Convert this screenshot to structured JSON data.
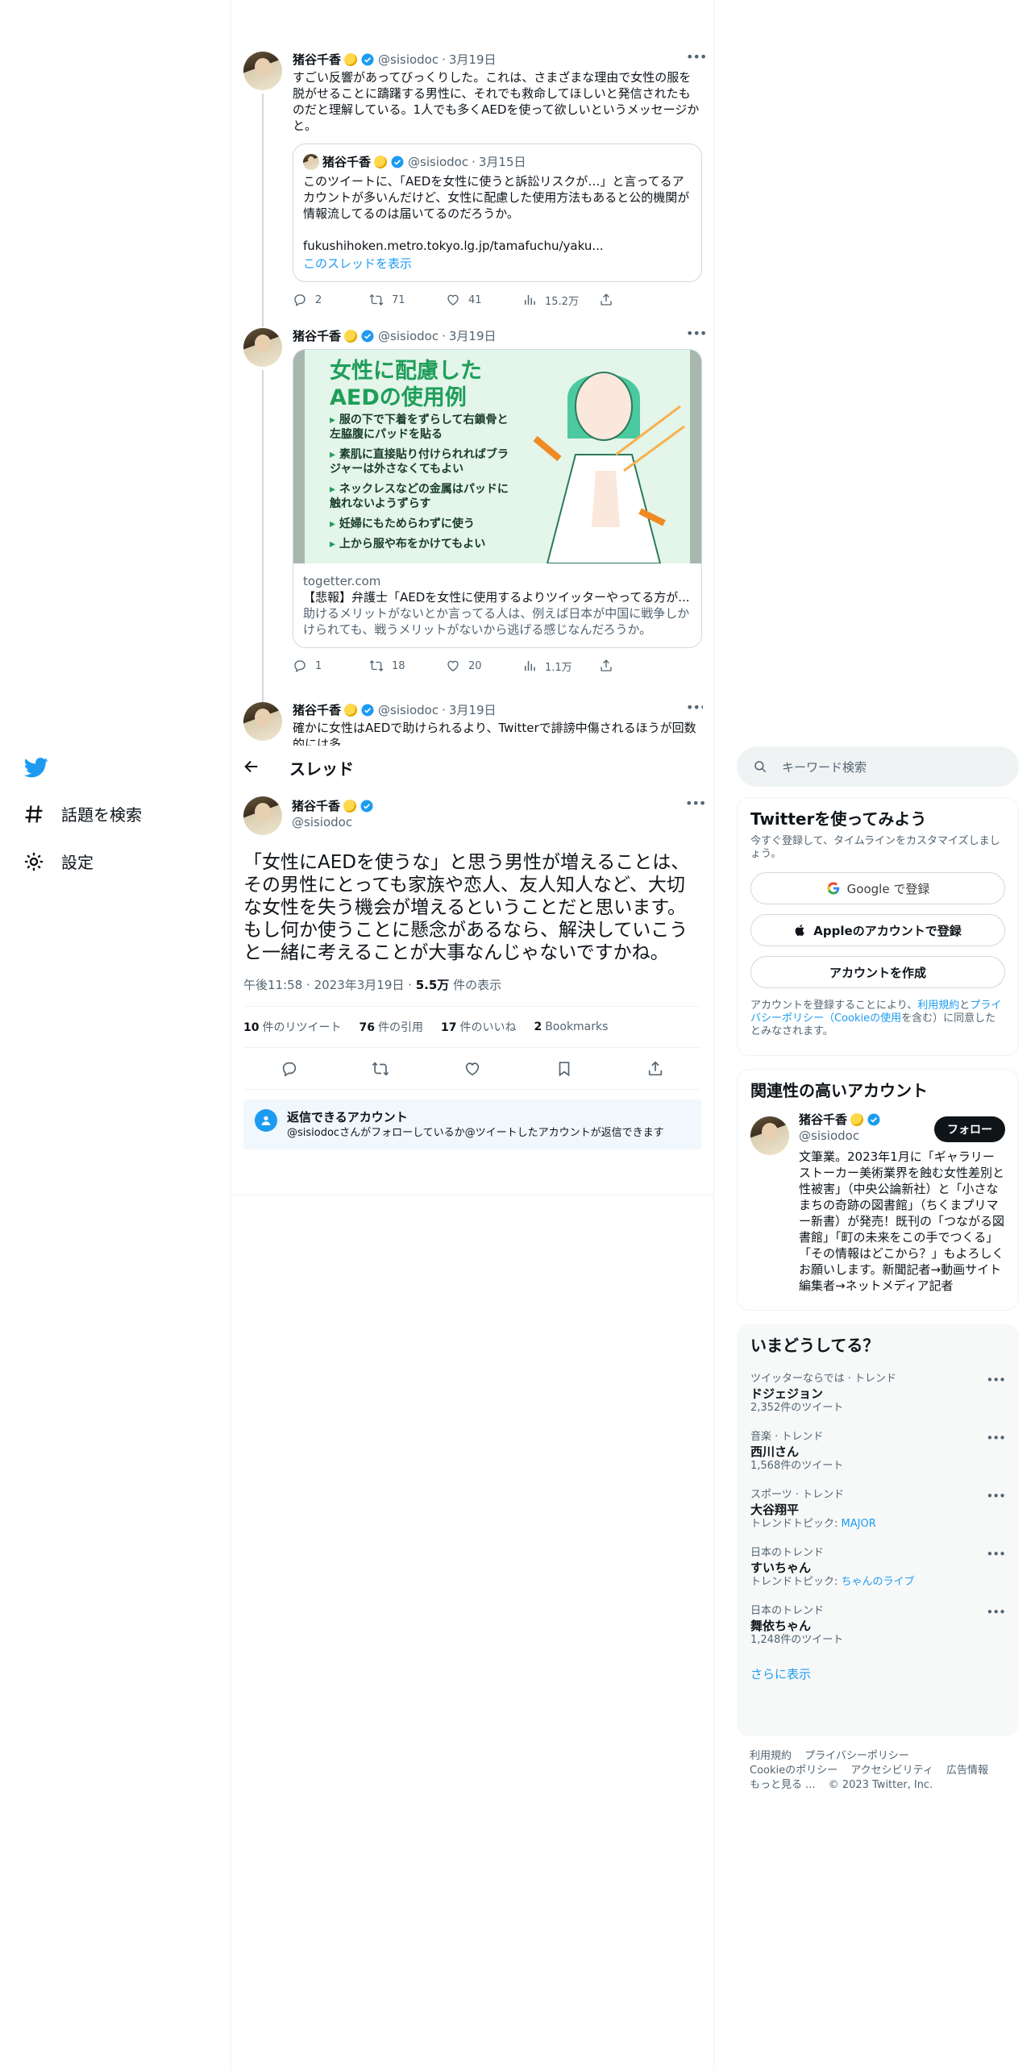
{
  "nav": {
    "explore_label": "話題を検索",
    "settings_label": "設定"
  },
  "header": {
    "title": "スレッド"
  },
  "tweets": [
    {
      "name": "猪谷千香",
      "handle": "@sisiodoc",
      "date": "3月19日",
      "text": "すごい反響があってびっくりした。これは、さまざまな理由で女性の服を脱がせることに躊躇する男性に、それでも救命してほしいと発信されたものだと理解している。1人でも多くAEDを使って欲しいというメッセージかと。",
      "quote": {
        "name": "猪谷千香",
        "handle": "@sisiodoc",
        "date": "3月15日",
        "text": "このツイートに、「AEDを女性に使うと訴訟リスクが…」と言ってるアカウントが多いんだけど、女性に配慮した使用方法もあると公的機関が情報流してるのは届いてるのだろうか。",
        "link": "fukushihoken.metro.tokyo.lg.jp/tamafuchu/yaku...",
        "thread_label": "このスレッドを表示"
      },
      "replies": "2",
      "retweets": "71",
      "likes": "41",
      "views": "15.2万"
    },
    {
      "name": "猪谷千香",
      "handle": "@sisiodoc",
      "date": "3月19日",
      "card": {
        "image_title": "女性に配慮したAEDの使用例",
        "image_items": [
          "服の下で下着をずらして右鎖骨と左脇腹にパッドを貼る",
          "素肌に直接貼り付けられればブラジャーは外さなくてもよい",
          "ネックレスなどの金属はパッドに触れないようずらす",
          "妊婦にもためらわずに使う",
          "上から服や布をかけてもよい"
        ],
        "domain": "togetter.com",
        "title": "【悲報】弁護士「AEDを女性に使用するよりツイッターやってる方が...",
        "desc": "助けるメリットがないとか言ってる人は、例えば日本が中国に戦争しかけられても、戦うメリットがないから逃げる感じなんだろうか。"
      },
      "replies": "1",
      "retweets": "18",
      "likes": "20",
      "views": "1.1万"
    },
    {
      "name": "猪谷千香",
      "handle": "@sisiodoc",
      "date": "3月19日",
      "text": "確かに女性はAEDで助けられるより、Twitterで誹謗中傷されるほうが回数的には多"
    }
  ],
  "focus": {
    "name": "猪谷千香",
    "handle": "@sisiodoc",
    "text": "「女性にAEDを使うな」と思う男性が増えることは、その男性にとっても家族や恋人、友人知人など、大切な女性を失う機会が増えるということだと思います。もし何か使うことに懸念があるなら、解決していこうと一緒に考えることが大事なんじゃないですかね。",
    "time": "午後11:58",
    "date": "2023年3月19日",
    "views": "5.5万",
    "views_suffix": "件の表示",
    "retweets": "10",
    "retweets_label": "件のリツイート",
    "quotes": "76",
    "quotes_label": "件の引用",
    "likes": "17",
    "likes_label": "件のいいね",
    "bookmarks": "2",
    "bookmarks_label": "Bookmarks",
    "reply_title": "返信できるアカウント",
    "reply_desc": "@sisiodocさんがフォローしているか@ツイートしたアカウントが返信できます"
  },
  "search": {
    "placeholder": "キーワード検索"
  },
  "signup": {
    "title": "Twitterを使ってみよう",
    "subtitle": "今すぐ登録して、タイムラインをカスタマイズしましょう。",
    "google": "Google で登録",
    "apple": "Appleのアカウントで登録",
    "create": "アカウントを作成",
    "legal_pre": "アカウントを登録することにより、",
    "legal_terms": "利用規約",
    "legal_and": "と",
    "legal_privacy": "プライバシーポリシー（Cookieの使用",
    "legal_post": "を含む）に同意したとみなされます。"
  },
  "related": {
    "title": "関連性の高いアカウント",
    "name": "猪谷千香",
    "handle": "@sisiodoc",
    "follow": "フォロー",
    "bio": "文筆業。2023年1月に「ギャラリーストーカー美術業界を蝕む女性差別と性被害」（中央公論新社）と「小さなまちの奇跡の図書館」（ちくまプリマー新書）が発売！既刊の「つながる図書館」「町の未来をこの手でつくる」「その情報はどこから？」もよろしくお願いします。新聞記者→動画サイト編集者→ネットメディア記者"
  },
  "trends": {
    "title": "いまどうしてる？",
    "items": [
      {
        "context": "ツイッターならでは · トレンド",
        "name": "ドジェジョン",
        "count": "2,352件のツイート",
        "topic_label": "",
        "topic": ""
      },
      {
        "context": "音楽 · トレンド",
        "name": "西川さん",
        "count": "1,568件のツイート",
        "topic_label": "",
        "topic": ""
      },
      {
        "context": "スポーツ · トレンド",
        "name": "大谷翔平",
        "count": "",
        "topic_label": "トレンドトピック: ",
        "topic": "MAJOR"
      },
      {
        "context": "日本のトレンド",
        "name": "すいちゃん",
        "count": "",
        "topic_label": "トレンドトピック: ",
        "topic": "ちゃんのライブ"
      },
      {
        "context": "日本のトレンド",
        "name": "舞依ちゃん",
        "count": "1,248件のツイート",
        "topic_label": "",
        "topic": ""
      }
    ],
    "show_more": "さらに表示"
  },
  "footer": {
    "terms": "利用規約",
    "privacy": "プライバシーポリシー",
    "cookie": "Cookieのポリシー",
    "accessibility": "アクセシビリティ",
    "ads": "広告情報",
    "more": "もっと見る ...",
    "copyright": "© 2023 Twitter, Inc."
  },
  "colors": {
    "accent": "#1d9bf0",
    "text": "#0f1419",
    "secondary": "#536471",
    "border": "#eff3f4"
  }
}
